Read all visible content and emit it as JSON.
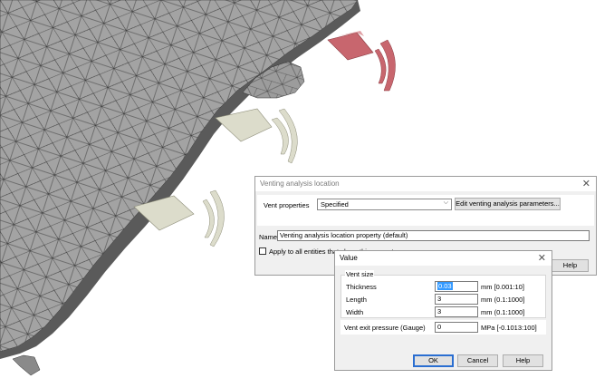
{
  "venting_dialog": {
    "title": "Venting analysis location",
    "vent_properties_label": "Vent properties",
    "vent_properties_value": "Specified",
    "edit_button": "Edit venting analysis parameters...",
    "name_label": "Name",
    "name_value": "Venting analysis location property (default)",
    "apply_all_label": "Apply to all entities that share this property",
    "help_button": "Help"
  },
  "value_dialog": {
    "title": "Value",
    "group_label": "Vent size",
    "rows": [
      {
        "label": "Thickness",
        "value": "0.03",
        "unit": "mm [0.001:10]"
      },
      {
        "label": "Length",
        "value": "3",
        "unit": "mm (0.1:1000]"
      },
      {
        "label": "Width",
        "value": "3",
        "unit": "mm (0.1:1000]"
      }
    ],
    "pressure": {
      "label": "Vent exit pressure (Gauge)",
      "value": "0",
      "unit": "MPa [-0.1013:100]"
    },
    "ok_button": "OK",
    "cancel_button": "Cancel",
    "help_button": "Help"
  },
  "colors": {
    "mesh_fill": "#a3a3a3",
    "mesh_line": "#2e2e2e",
    "vent_beige": "#dcdccb",
    "vent_red": "#c8666e",
    "selection": "#3399ff"
  }
}
